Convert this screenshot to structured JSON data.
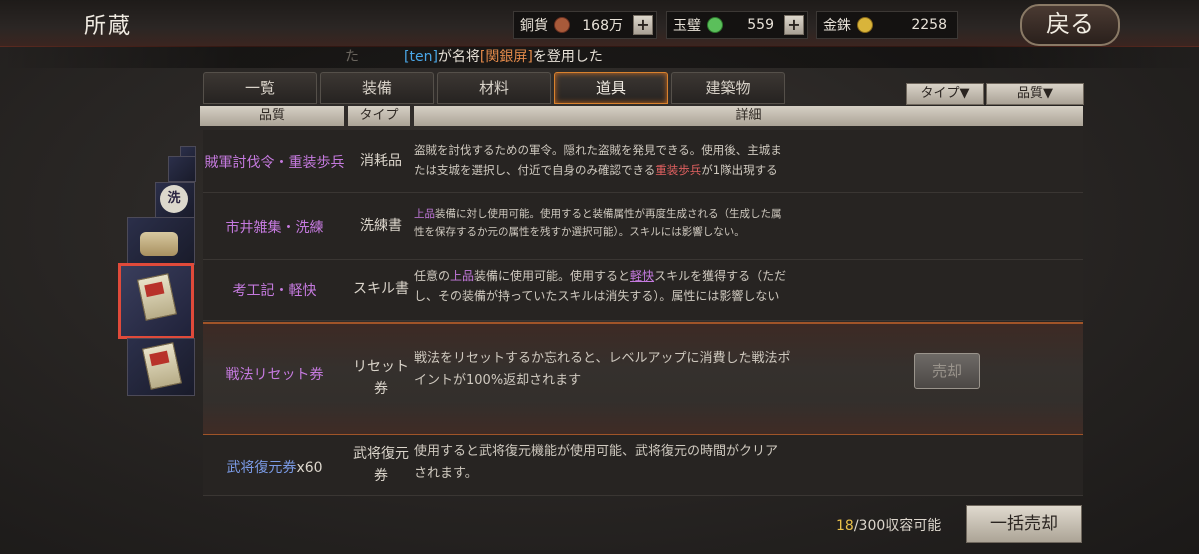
{
  "header": {
    "title": "所蔵",
    "back_label": "戻る",
    "currencies": [
      {
        "label": "銅貨",
        "value": "168万",
        "color": "#a85a3a",
        "icon": "copper-coin-icon"
      },
      {
        "label": "玉璧",
        "value": "559",
        "color": "#5bbf5b",
        "icon": "jade-icon"
      },
      {
        "label": "金銖",
        "value": "2258",
        "color": "#d9b43a",
        "icon": "gold-coin-icon"
      }
    ],
    "plus_label": "+"
  },
  "notice": {
    "faded": "た",
    "user": "[ten]",
    "text1": "が名将",
    "hero": "[関銀屏]",
    "text2": "を登用した"
  },
  "tabs": [
    {
      "label": "一覧",
      "active": false
    },
    {
      "label": "装備",
      "active": false
    },
    {
      "label": "材料",
      "active": false
    },
    {
      "label": "道具",
      "active": true
    },
    {
      "label": "建築物",
      "active": false
    }
  ],
  "filters": {
    "type": "タイプ▼",
    "quality": "品質▼"
  },
  "columns": {
    "quality": "品質",
    "type": "タイプ",
    "detail": "詳細"
  },
  "items": [
    {
      "name": "賊軍討伐令・重装歩兵",
      "type": "消耗品",
      "d1": "盗賊を討伐するための軍令。隠れた盗賊を発見できる。使用後、主城ま",
      "d2a": "たは支城を選択し、付近で自身のみ確認できる",
      "d2h": "重装歩兵",
      "d2b": "が1隊出現する"
    },
    {
      "name": "市井雑集・洗練",
      "type": "洗練書",
      "d1h": "上品",
      "d1": "装備に対し使用可能。使用すると装備属性が再度生成される（生成した属",
      "d2": "性を保存するか元の属性を残すか選択可能）。スキルには影響しない。"
    },
    {
      "name": "考工記・軽快",
      "type": "スキル書",
      "d1a": "任意の",
      "d1h": "上品",
      "d1b": "装備に使用可能。使用すると",
      "d1u": "軽快",
      "d1c": "スキルを獲得する（ただ",
      "d2": "し、その装備が持っていたスキルは消失する）。属性には影響しない"
    },
    {
      "name": "戦法リセット券",
      "type1": "リセット",
      "type2": "券",
      "d1": "戦法をリセットするか忘れると、レベルアップに消費した戦法ポ",
      "d2": "イントが100%返却されます",
      "sell": "売却"
    },
    {
      "name": "武将復元券",
      "qty": "x60",
      "type1": "武将復元",
      "type2": "券",
      "d1": "使用すると武将復元機能が使用可能、武将復元の時間がクリア",
      "d2": "されます。"
    }
  ],
  "footer": {
    "used": "18",
    "capacity": "/300収容可能",
    "bulk_sell": "一括売却"
  }
}
